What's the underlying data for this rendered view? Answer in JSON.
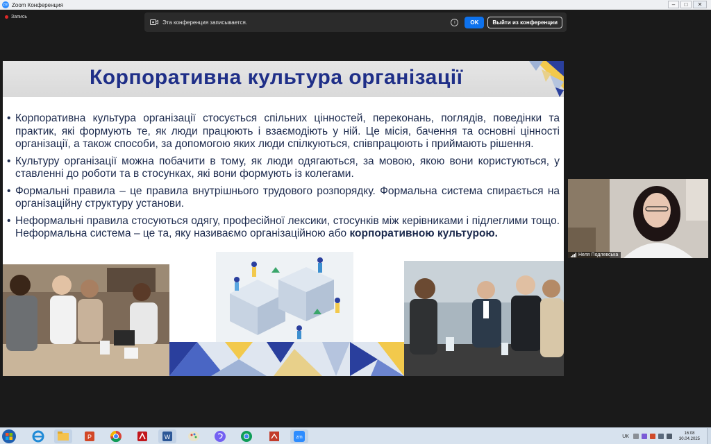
{
  "window": {
    "title": "Zoom Конференция",
    "app_icon_text": "zm",
    "controls": [
      "–",
      "□",
      "✕"
    ]
  },
  "recording": {
    "label": "Запись"
  },
  "notice": {
    "text": "Эта конференция записывается.",
    "info_icon": "i",
    "ok_label": "OK",
    "leave_label": "Выйти из конференции"
  },
  "slide": {
    "title": "Корпоративна культура організації",
    "bullets": [
      {
        "text": "Корпоративна культура організації стосується спільних цінностей, переконань, поглядів, поведінки та практик, які формують те, як люди працюють і взаємодіють у ній. Це місія, бачення та основні цінності організації, а також способи, за допомогою яких люди спілкуються, співпрацюють і приймають рішення.",
        "bold": ""
      },
      {
        "text": "Культуру організації можна побачити в тому, як люди одягаються, за мовою, якою вони користуються, у ставленні до роботи та в стосунках, які вони формують із колегами.",
        "bold": ""
      },
      {
        "text": "Формальні правила – це правила внутрішнього трудового розпорядку. Формальна система спирається на організаційну структуру установи.",
        "bold": ""
      },
      {
        "text": "Неформальні правила стосуються одягу, професійної лексики, стосунків між керівниками і підлеглими тощо. Неформальна система – це та, яку називаємо організаційною або ",
        "bold": "корпоративною культурою."
      }
    ],
    "bullet_char": "•",
    "colors": {
      "title": "#1f2f88",
      "text": "#1c2a4d",
      "header_bg": "#dedede"
    }
  },
  "participant": {
    "name": "Неля Подлевська"
  },
  "taskbar": {
    "apps": [
      "windows-explorer-icon",
      "internet-explorer-icon",
      "file-explorer-icon",
      "powerpoint-icon",
      "chrome-icon",
      "acrobat-icon",
      "word-icon",
      "paint-icon",
      "viber-icon",
      "chrome-profile-icon",
      "presentation-icon",
      "zoom-icon"
    ],
    "language": "UK",
    "time": "16:08",
    "date": "30.04.2025"
  }
}
